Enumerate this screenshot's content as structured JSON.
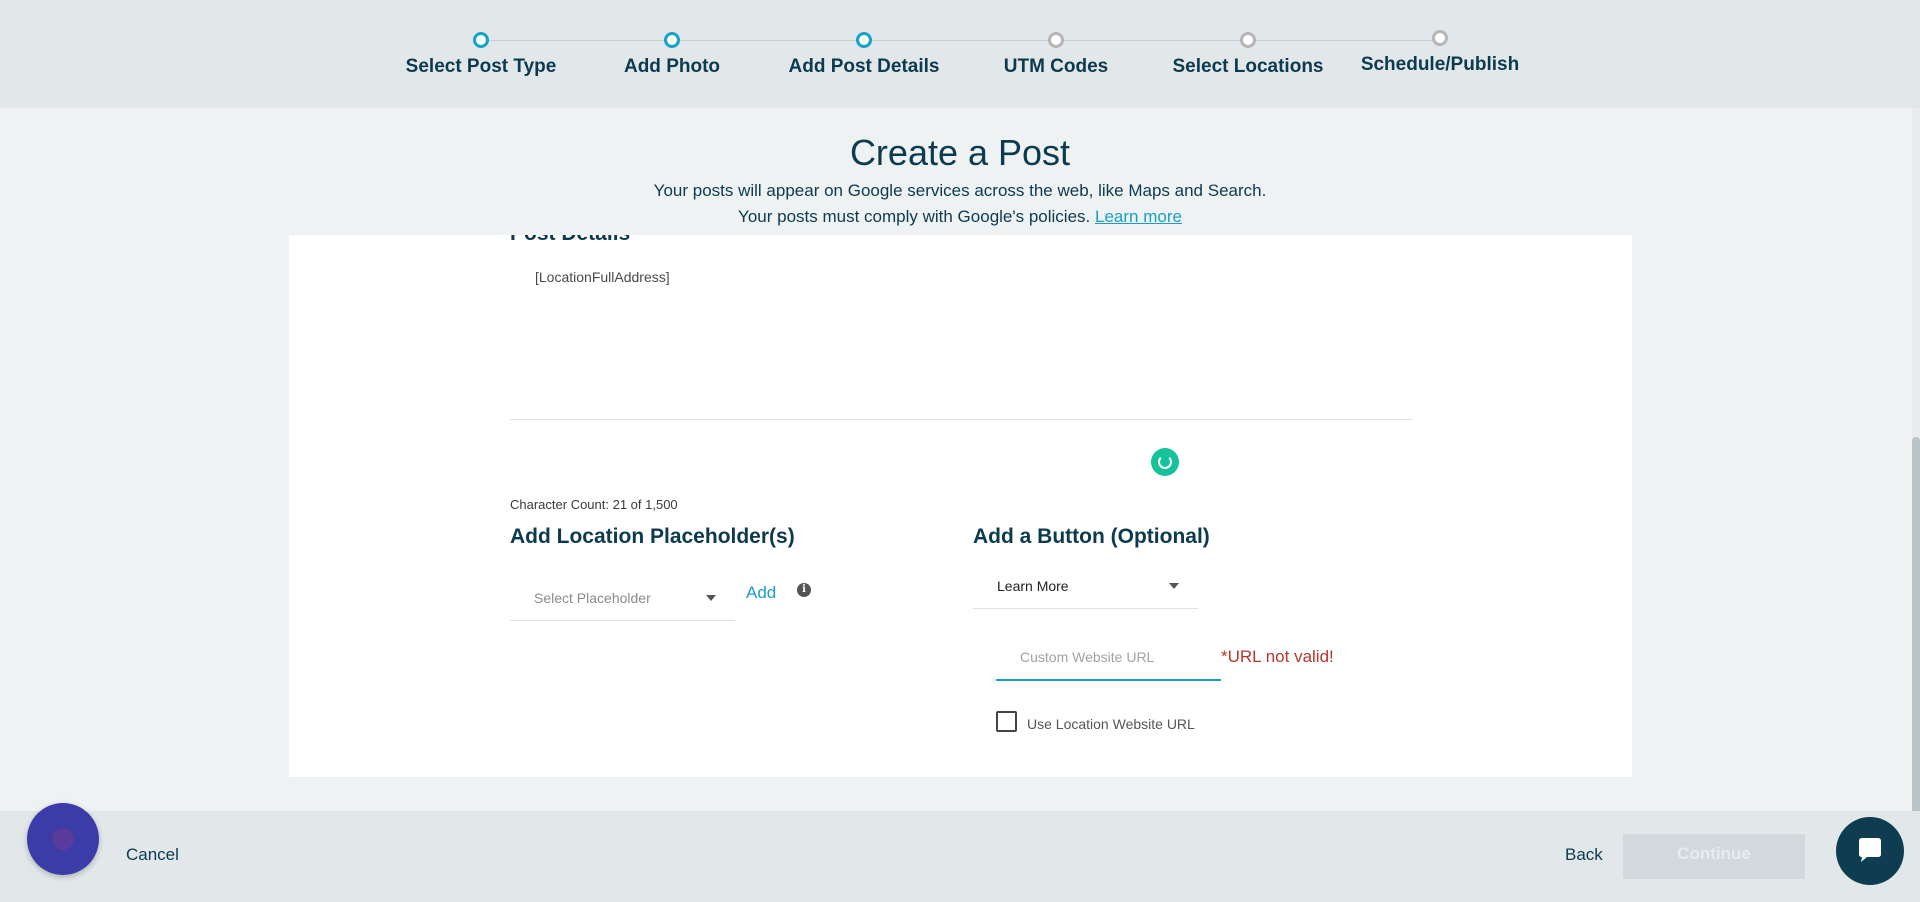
{
  "stepper": {
    "steps": [
      {
        "label": "Select Post Type",
        "state": "complete"
      },
      {
        "label": "Add Photo",
        "state": "complete"
      },
      {
        "label": "Add Post Details",
        "state": "current"
      },
      {
        "label": "UTM Codes",
        "state": "future"
      },
      {
        "label": "Select Locations",
        "state": "future"
      },
      {
        "label": "Schedule/Publish",
        "state": "future"
      }
    ]
  },
  "header": {
    "title": "Create a Post",
    "subtitle_line1": "Your posts will appear on Google services across the web, like Maps and Search.",
    "subtitle_line2": "Your posts must comply with Google's policies.",
    "learn_more_link": "Learn more"
  },
  "post_details": {
    "section_title": "Post Details",
    "body_text": "[LocationFullAddress]",
    "character_count": "Character Count: 21 of 1,500"
  },
  "placeholders": {
    "title": "Add Location Placeholder(s)",
    "select_placeholder": "Select Placeholder",
    "add_label": "Add",
    "info_icon_glyph": "i"
  },
  "button_section": {
    "title": "Add a Button (Optional)",
    "selected_button": "Learn More",
    "url_placeholder": "Custom Website URL",
    "url_value": "",
    "url_error": "*URL not valid!",
    "use_location_url_label": "Use Location Website URL",
    "use_location_url_checked": false
  },
  "footer": {
    "cancel_label": "Cancel",
    "back_label": "Back",
    "continue_label": "Continue"
  },
  "colors": {
    "accent": "#15a4c9",
    "navy": "#0c3a4f",
    "error": "#b0392b",
    "grammarly": "#15c39a",
    "chat_fab": "#0e3d52",
    "help_fab": "#3b3ca8"
  },
  "icons": {
    "grammarly": "grammarly-icon",
    "info": "info-icon",
    "chat": "chat-bubble-icon",
    "dropdown": "caret-down-icon"
  }
}
